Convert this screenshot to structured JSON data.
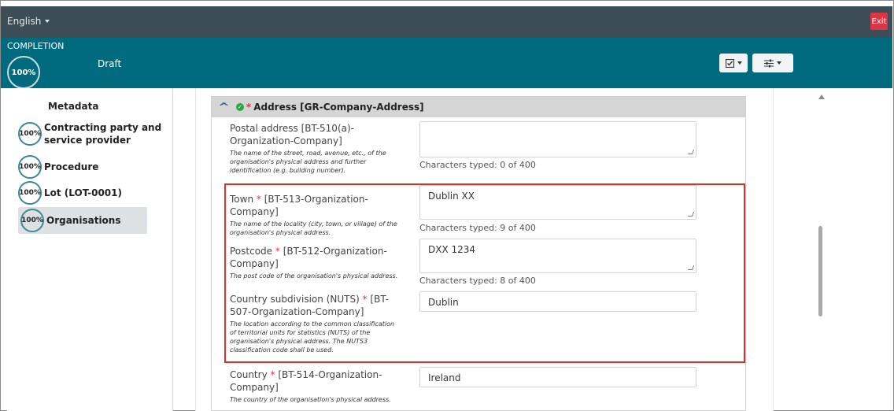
{
  "topbar": {
    "language": "English",
    "exit_label": "Exit"
  },
  "status": {
    "completion_label": "COMPLETION",
    "completion_pct": "100%",
    "state": "Draft",
    "completion_value": 1.0
  },
  "toolbar": {
    "btn1_icon": "check-square-icon",
    "btn2_icon": "sliders-icon"
  },
  "sidebar": {
    "title": "Metadata",
    "items": [
      {
        "pct": "100%",
        "label_line1": "Contracting party and",
        "label_line2": "service provider"
      },
      {
        "pct": "100%",
        "label_line1": "Procedure",
        "label_line2": ""
      },
      {
        "pct": "100%",
        "label_line1": "Lot (LOT-0001)",
        "label_line2": ""
      },
      {
        "pct": "100%",
        "label_line1": "Organisations",
        "label_line2": ""
      }
    ]
  },
  "section": {
    "title_mark": "*",
    "title": "Address  [GR-Company-Address]",
    "fields": {
      "postal": {
        "label": "Postal address [BT-510(a)-Organization-Company]",
        "help": "The name of the street, road, avenue, etc., of the organisation's physical address and further identification (e.g. building number).",
        "value": "",
        "counter": "Characters typed: 0 of 400"
      },
      "town": {
        "label_pre": "Town",
        "label_post": "[BT-513-Organization-Company]",
        "help": "The name of the locality (city, town, or village) of the organisation's physical address.",
        "value": "Dublin XX",
        "counter": "Characters typed: 9 of 400"
      },
      "postcode": {
        "label_pre": "Postcode",
        "label_post": "[BT-512-Organization-Company]",
        "help": "The post code of the organisation's physical address.",
        "value": "DXX 1234",
        "counter": "Characters typed: 8 of 400"
      },
      "nuts": {
        "label_pre": "Country subdivision (NUTS)",
        "label_post": "[BT-507-Organization-Company]",
        "help": "The location according to the common classification of territorial units for statistics (NUTS) of the organisation's physical address. The NUTS3 classification code shall be used.",
        "value": "Dublin"
      },
      "country": {
        "label_pre": "Country",
        "label_post": "[BT-514-Organization-Company]",
        "help": "The country of the organisation's physical address.",
        "value": "Ireland"
      }
    }
  },
  "colors": {
    "topbar": "#3c4d57",
    "statusbar": "#006b7e",
    "exit": "#dc3545",
    "highlight": "#d9302c",
    "required": "#dc3545"
  }
}
